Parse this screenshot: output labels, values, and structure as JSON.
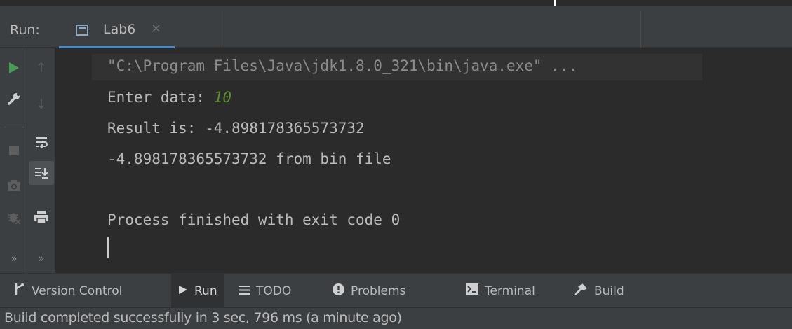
{
  "run_panel": {
    "label": "Run:",
    "tab": {
      "label": "Lab6",
      "close": "×"
    }
  },
  "toolbar_left": [
    {
      "name": "rerun-icon",
      "glyph": "play"
    },
    {
      "name": "wrench-icon",
      "glyph": "wrench"
    },
    {
      "name": "stop-icon",
      "glyph": "stop"
    },
    {
      "name": "camera-icon",
      "glyph": "camera"
    },
    {
      "name": "bug-icon",
      "glyph": "bug"
    },
    {
      "name": "more-icon",
      "glyph": "»"
    }
  ],
  "toolbar_right": [
    {
      "name": "arrow-up-icon",
      "glyph": "↑"
    },
    {
      "name": "arrow-down-icon",
      "glyph": "↓"
    },
    {
      "name": "soft-wrap-icon",
      "glyph": "wrap"
    },
    {
      "name": "scroll-to-end-icon",
      "glyph": "scroll"
    },
    {
      "name": "print-icon",
      "glyph": "print"
    },
    {
      "name": "more-icon",
      "glyph": "»"
    }
  ],
  "console": {
    "command": "\"C:\\Program Files\\Java\\jdk1.8.0_321\\bin\\java.exe\" ...",
    "prompt": "Enter data: ",
    "input_value": "10",
    "result_line": "Result is: -4.898178365573732",
    "bin_line": "-4.898178365573732 from bin file",
    "exit_line": "Process finished with exit code 0"
  },
  "bottom_tabs": [
    {
      "label": "Version Control",
      "icon": "version-control-icon"
    },
    {
      "label": "Run",
      "icon": "run-icon",
      "active": true
    },
    {
      "label": "TODO",
      "icon": "todo-icon"
    },
    {
      "label": "Problems",
      "icon": "problems-icon"
    },
    {
      "label": "Terminal",
      "icon": "terminal-icon"
    },
    {
      "label": "Build",
      "icon": "build-icon"
    }
  ],
  "status_bar": {
    "message": "Build completed successfully in 3 sec, 796 ms (a minute ago)"
  },
  "colors": {
    "background": "#2b2b2b",
    "panel": "#3c3f41",
    "accent": "#4a88c7",
    "run_green": "#499c54",
    "input_green": "#5b8f2f"
  }
}
